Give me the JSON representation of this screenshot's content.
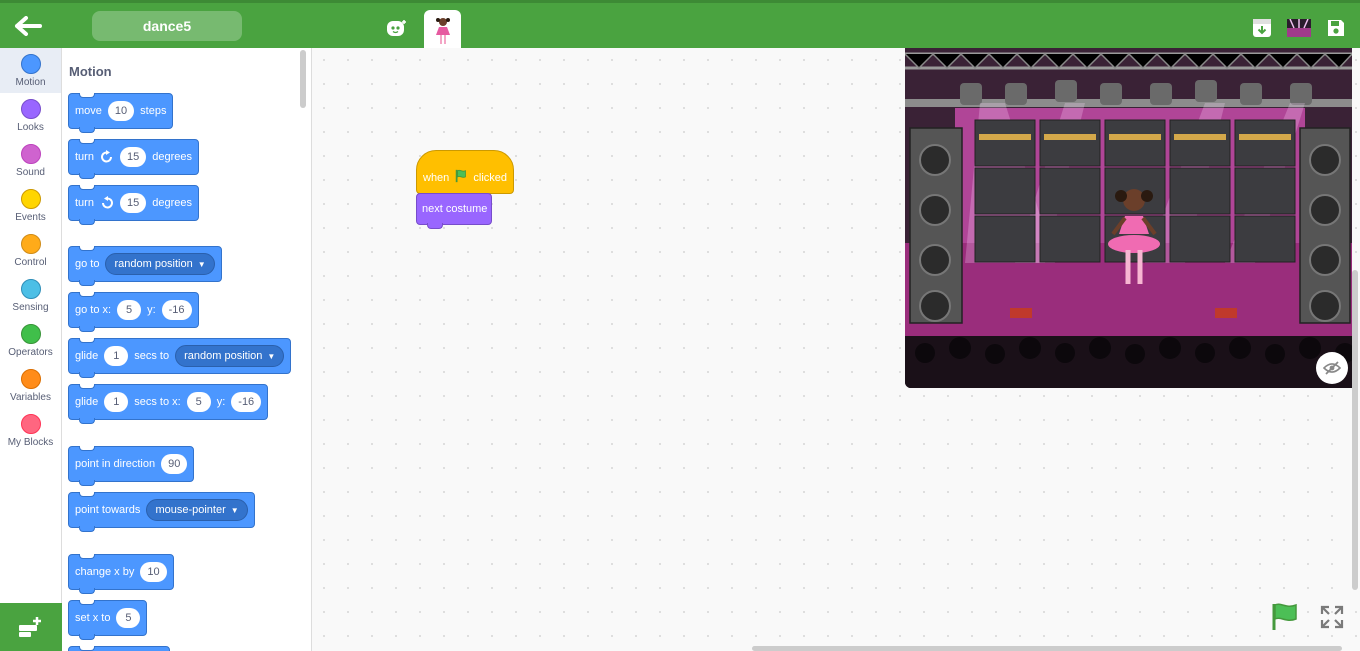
{
  "topbar": {
    "project_title": "dance5",
    "back_icon": "arrow-left-icon",
    "tabs": [
      {
        "name": "blocks",
        "icon": "robot-face-icon"
      },
      {
        "name": "sprite",
        "icon": "dancer-sprite-icon"
      }
    ],
    "right_buttons": [
      "download-icon",
      "backdrop-icon",
      "save-icon"
    ]
  },
  "categories": [
    {
      "label": "Motion",
      "color": "#4c97ff"
    },
    {
      "label": "Looks",
      "color": "#9966ff"
    },
    {
      "label": "Sound",
      "color": "#cf63cf"
    },
    {
      "label": "Events",
      "color": "#ffd500"
    },
    {
      "label": "Control",
      "color": "#ffab19"
    },
    {
      "label": "Sensing",
      "color": "#4cbfe6"
    },
    {
      "label": "Operators",
      "color": "#40bf4a"
    },
    {
      "label": "Variables",
      "color": "#ff8c1a"
    },
    {
      "label": "My Blocks",
      "color": "#ff6680"
    }
  ],
  "palette": {
    "title": "Motion",
    "blocks": {
      "move": {
        "a": "move",
        "v": "10",
        "b": "steps"
      },
      "turn_right": {
        "a": "turn",
        "v": "15",
        "b": "degrees"
      },
      "turn_left": {
        "a": "turn",
        "v": "15",
        "b": "degrees"
      },
      "goto": {
        "a": "go to",
        "drop": "random position"
      },
      "goto_xy": {
        "a": "go to x:",
        "x": "5",
        "ylabel": "y:",
        "y": "-16"
      },
      "glide_to": {
        "a": "glide",
        "v": "1",
        "b": "secs to",
        "drop": "random position"
      },
      "glide_xy": {
        "a": "glide",
        "v": "1",
        "b": "secs to x:",
        "x": "5",
        "ylabel": "y:",
        "y": "-16"
      },
      "point_dir": {
        "a": "point in direction",
        "v": "90"
      },
      "point_towards": {
        "a": "point towards",
        "drop": "mouse-pointer"
      },
      "change_x": {
        "a": "change x by",
        "v": "10"
      },
      "set_x": {
        "a": "set x to",
        "v": "5"
      }
    }
  },
  "script": {
    "hat": {
      "a": "when",
      "b": "clicked"
    },
    "next": "next costume"
  },
  "colors": {
    "topbar": "#4aa340",
    "motion": "#4c97ff",
    "events": "#ffbf00",
    "looks": "#9966ff"
  }
}
